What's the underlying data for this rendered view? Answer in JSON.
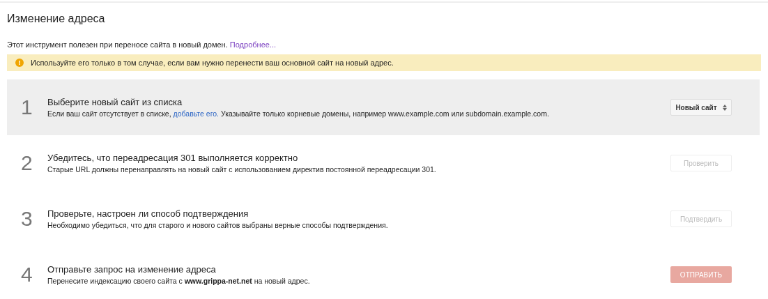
{
  "title": "Изменение адреса",
  "intro": {
    "text": "Этот инструмент полезен при переносе сайта в новый домен.",
    "link": "Подробнее..."
  },
  "warning": {
    "icon": "!",
    "text": "Используйте его только в том случае, если вам нужно перенести ваш основной сайт на новый адрес."
  },
  "steps": [
    {
      "number": "1",
      "title": "Выберите новый сайт из списка",
      "active": true,
      "description": [
        {
          "kind": "text",
          "text": "Если ваш сайт отсутствует в списке,"
        },
        {
          "kind": "link",
          "text": "добавьте его."
        },
        {
          "kind": "text",
          "text": "Указывайте только корневые домены, например www.example.com или subdomain.example.com."
        }
      ],
      "control": {
        "kind": "select",
        "label": "Новый сайт",
        "disabled": false
      }
    },
    {
      "number": "2",
      "title": "Убедитесь, что переадресация 301 выполняется корректно",
      "active": false,
      "description": [
        {
          "kind": "text",
          "text": "Старые URL должны перенаправлять на новый сайт с использованием директив постоянной переадресации 301."
        }
      ],
      "control": {
        "kind": "button",
        "label": "Проверить",
        "disabled": true
      }
    },
    {
      "number": "3",
      "title": "Проверьте, настроен ли способ подтверждения",
      "active": false,
      "description": [
        {
          "kind": "text",
          "text": "Необходимо убедиться, что для старого и нового сайтов выбраны верные способы подтверждения."
        }
      ],
      "control": {
        "kind": "button",
        "label": "Подтвердить",
        "disabled": true
      }
    },
    {
      "number": "4",
      "title": "Отправьте запрос на изменение адреса",
      "active": false,
      "description": [
        {
          "kind": "text",
          "text": "Перенесите индексацию своего сайта с **www.grippa-net.net** на новый адрес."
        }
      ],
      "control": {
        "kind": "primary",
        "label": "ОТПРАВИТЬ",
        "disabled": true
      }
    }
  ]
}
